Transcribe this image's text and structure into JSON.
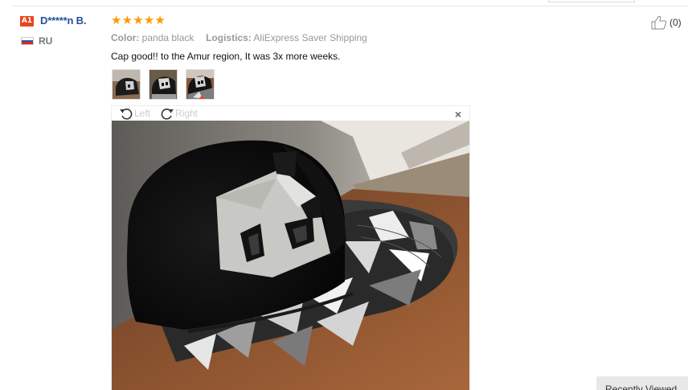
{
  "review": {
    "badge": "A1",
    "user_name": "D*****n B.",
    "country": "RU",
    "stars": [
      "★",
      "★",
      "★",
      "★",
      "★"
    ],
    "rating": 5,
    "helpful_count": "(0)",
    "color_label": "Color:",
    "color_value": "panda black",
    "logistics_label": "Logistics:",
    "logistics_value": "AliExpress Saver Shipping",
    "text": "Cap good!! to the Amur region, It was 3x more weeks."
  },
  "viewer": {
    "rotate_left": "Left",
    "rotate_right": "Right",
    "close": "×"
  },
  "footer": {
    "recently_viewed": "Recently Viewed"
  },
  "colors": {
    "badge": "#e8461e",
    "user_name": "#23519b",
    "stars": "#ff9a00"
  },
  "icons": [
    "thumbs-up-icon",
    "rotate-left-icon",
    "rotate-right-icon",
    "close-icon",
    "russia-flag-icon"
  ]
}
